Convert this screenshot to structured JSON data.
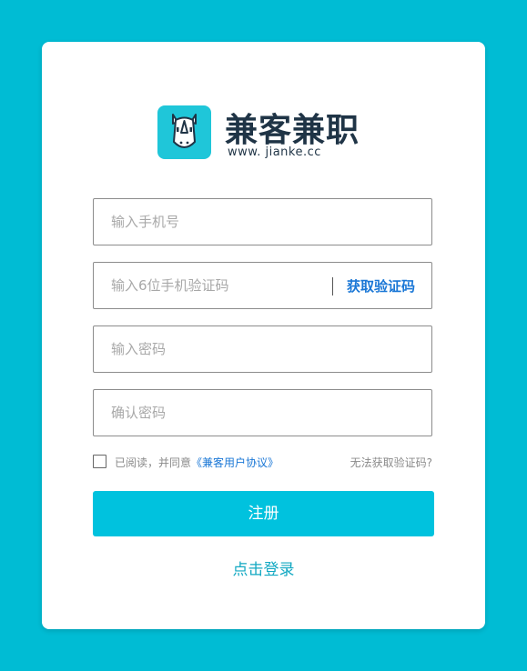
{
  "brand": {
    "name": "兼客兼职",
    "url": "www. jianke.cc",
    "logo_icon": "rhino-icon",
    "logo_color": "#1fc6d9"
  },
  "form": {
    "phone_placeholder": "输入手机号",
    "code_placeholder": "输入6位手机验证码",
    "get_code_label": "获取验证码",
    "password_placeholder": "输入密码",
    "confirm_password_placeholder": "确认密码",
    "agree_prefix": "已阅读，并同意",
    "agreement_link": "《兼客用户协议》",
    "cant_get_code": "无法获取验证码?",
    "register_label": "注册",
    "login_link": "点击登录"
  },
  "colors": {
    "background": "#00bcd4",
    "primary_button": "#00c2de",
    "link": "#1a77d6"
  }
}
